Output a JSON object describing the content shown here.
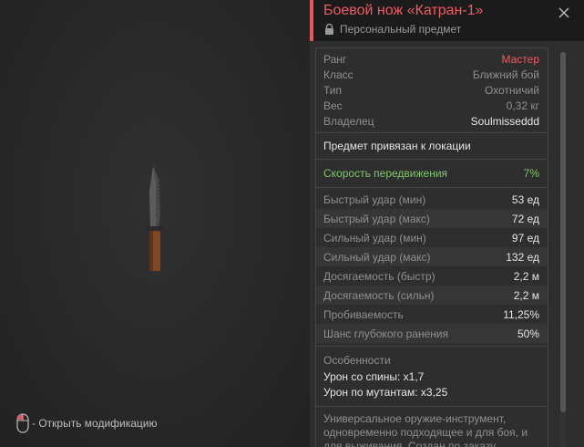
{
  "item": {
    "title": "Боевой нож «Катран-1»",
    "subtitle": "Персональный предмет"
  },
  "info": [
    {
      "label": "Ранг",
      "value": "Мастер"
    },
    {
      "label": "Класс",
      "value": "Ближний бой"
    },
    {
      "label": "Тип",
      "value": "Охотничий"
    },
    {
      "label": "Вес",
      "value": "0,32 кг"
    },
    {
      "label": "Владелец",
      "value": "Soulmisseddd"
    }
  ],
  "bound_text": "Предмет привязан к локации",
  "speed": {
    "label": "Скорость передвижения",
    "value": "7%"
  },
  "stats": [
    {
      "label": "Быстрый удар (мин)",
      "value": "53 ед"
    },
    {
      "label": "Быстрый удар (макс)",
      "value": "72 ед"
    },
    {
      "label": "Сильный удар (мин)",
      "value": "97 ед"
    },
    {
      "label": "Сильный удар (макс)",
      "value": "132 ед"
    },
    {
      "label": "Досягаемость (быстр)",
      "value": "2,2 м"
    },
    {
      "label": "Досягаемость (сильн)",
      "value": "2,2 м"
    },
    {
      "label": "Пробиваемость",
      "value": "11,25%"
    },
    {
      "label": "Шанс глубокого ранения",
      "value": "50%"
    }
  ],
  "features": {
    "title": "Особенности",
    "lines": [
      "Урон со спины: x1,7",
      "Урон по мутантам: x3,25"
    ]
  },
  "description": "Универсальное оружие-инструмент, одновременно подходящее и для боя, и для выживания. Создан по заказу",
  "hint": {
    "text": "- Открыть модификацию"
  },
  "colors": {
    "accent": "#ef5a62",
    "positive": "#7ec66a",
    "panel": "#2e2e2e",
    "header": "#1b1b1b"
  },
  "icons": [
    "mouse-icon",
    "lock-icon",
    "close-icon",
    "knife-image"
  ]
}
